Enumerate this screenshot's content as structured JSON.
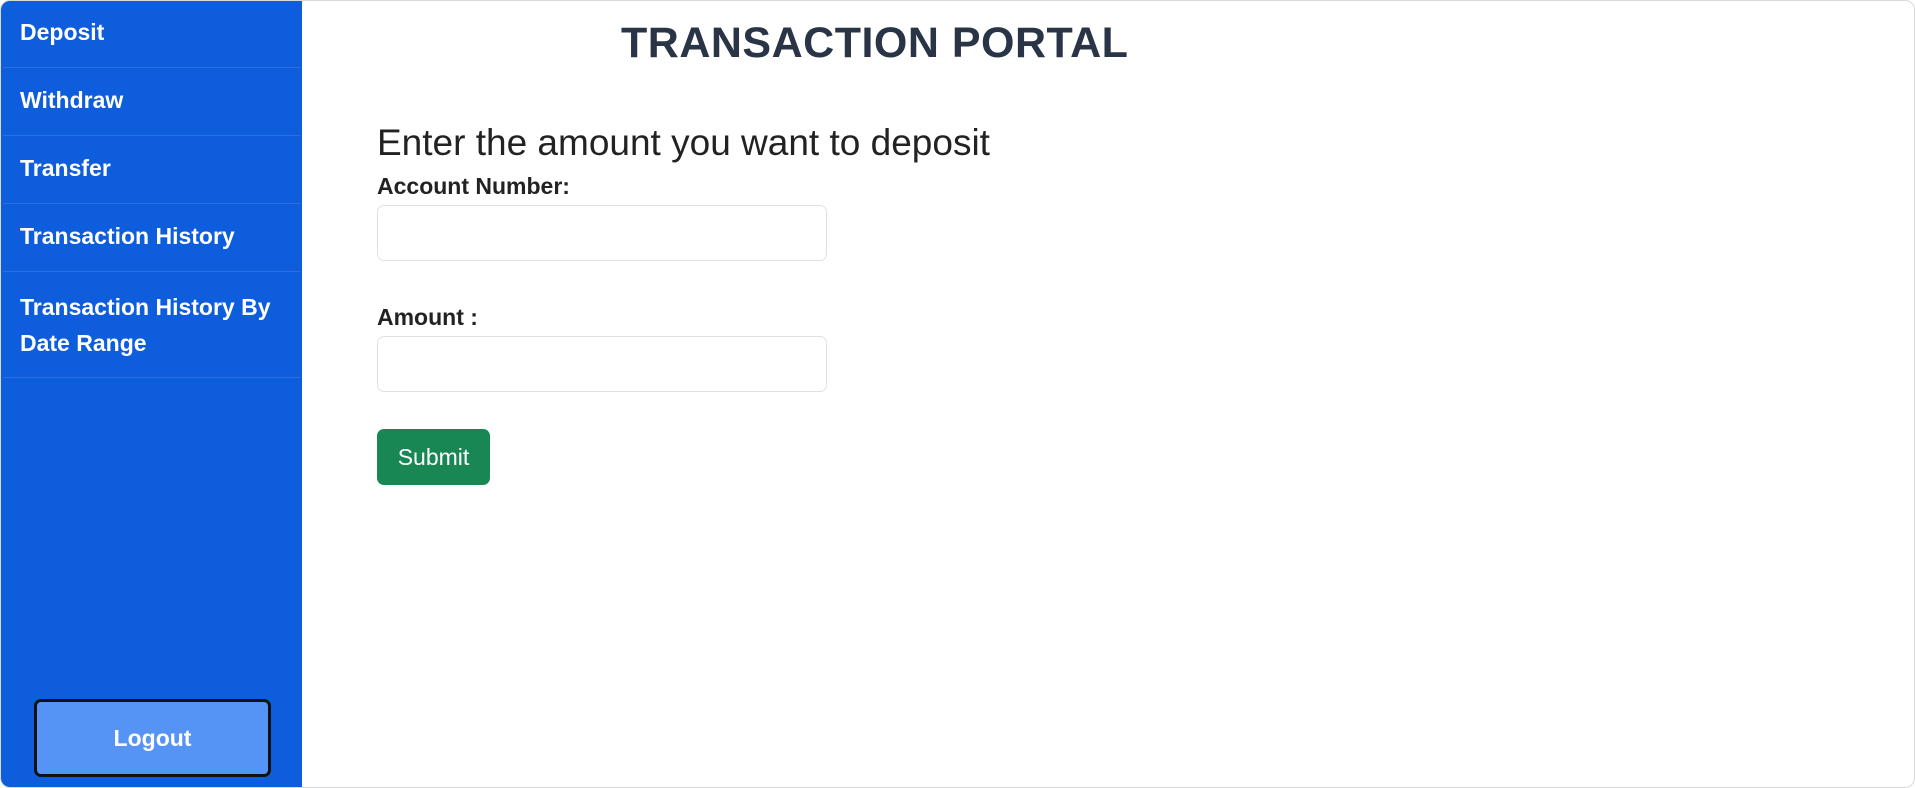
{
  "sidebar": {
    "items": [
      {
        "label": "Deposit"
      },
      {
        "label": "Withdraw"
      },
      {
        "label": "Transfer"
      },
      {
        "label": "Transaction History"
      },
      {
        "label": "Transaction History By Date Range"
      }
    ],
    "logout_label": "Logout"
  },
  "header": {
    "title": "TRANSACTION PORTAL"
  },
  "form": {
    "heading": "Enter the amount you want to deposit",
    "account_label": "Account Number:",
    "account_value": "",
    "amount_label": "Amount :",
    "amount_value": "",
    "submit_label": "Submit"
  },
  "colors": {
    "sidebar": "#0d5ddc",
    "logout_button": "#5593f5",
    "submit_button": "#198754",
    "title_text": "#293446"
  }
}
